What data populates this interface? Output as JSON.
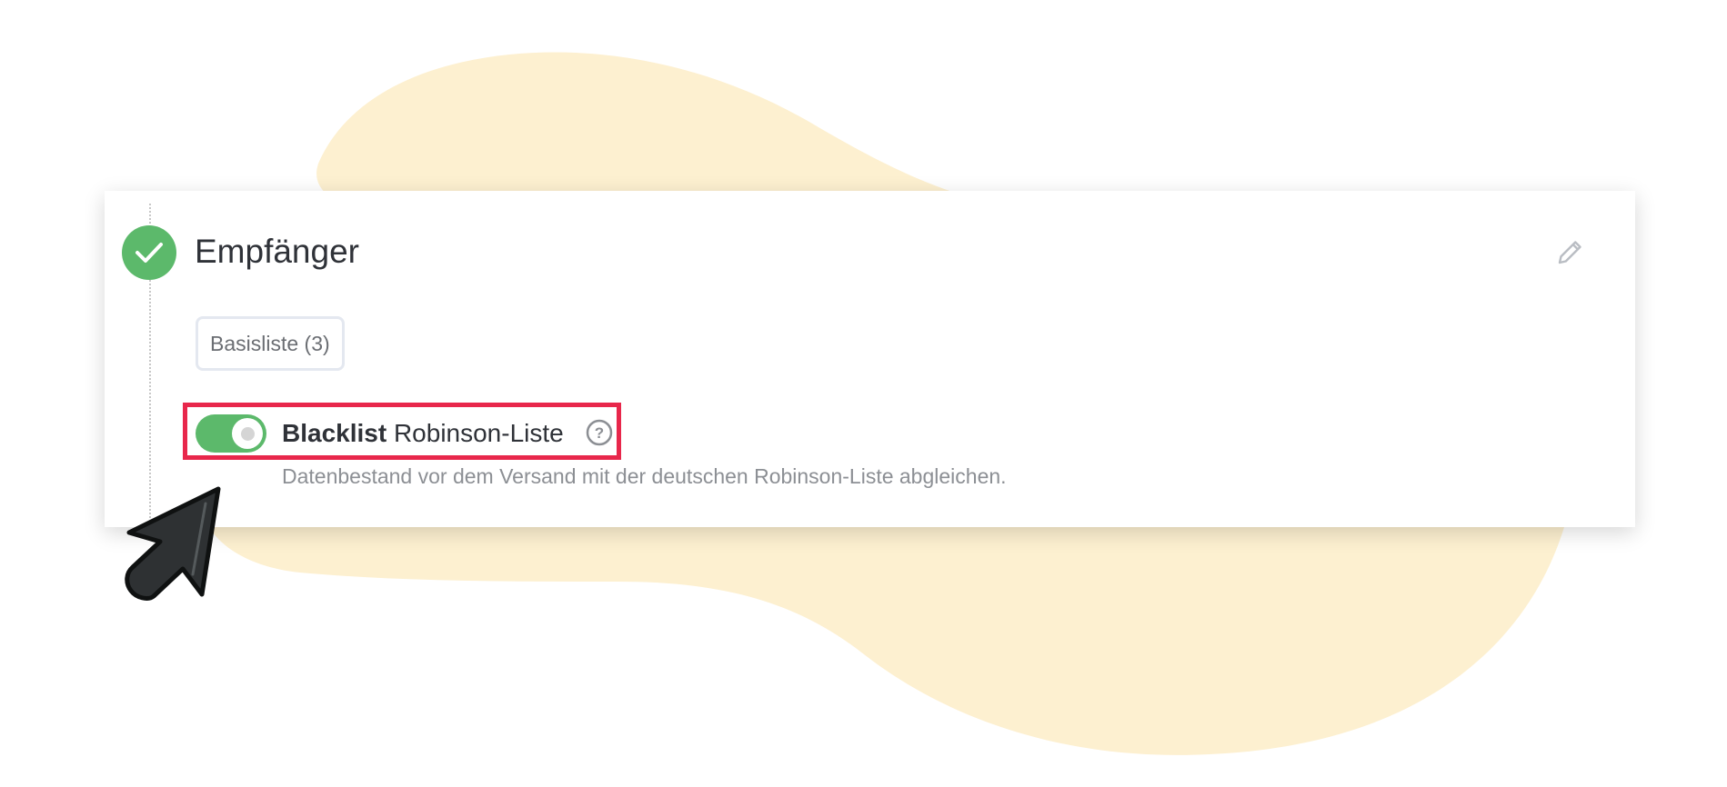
{
  "step": {
    "title": "Empfänger",
    "status_icon": "check-icon",
    "edit_icon": "pencil-icon"
  },
  "list_tag": {
    "label": "Basisliste (3)"
  },
  "blacklist": {
    "title_bold": "Blacklist",
    "title_rest": "Robinson-Liste",
    "enabled": true,
    "help_icon": "question-circle-icon",
    "description": "Datenbestand vor dem Versand mit der deutschen Robinson-Liste abgleichen."
  },
  "colors": {
    "success": "#5cb96b",
    "highlight": "#e8274b",
    "blob": "#fdf0d0"
  }
}
